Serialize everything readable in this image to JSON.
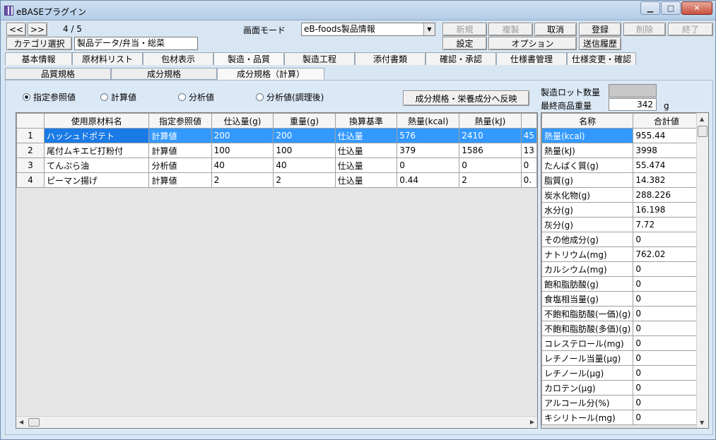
{
  "window": {
    "title": "eBASEプラグイン"
  },
  "nav": {
    "prev": "<<",
    "next": ">>",
    "record": "4 / 5"
  },
  "screen_mode": {
    "label": "画面モード",
    "value": "eB-foods製品情報"
  },
  "category": {
    "label": "カテゴリ選択",
    "value": "製品データ/弁当・総菜"
  },
  "toolbar": {
    "new": "新規",
    "copy": "複製",
    "cancel": "取消",
    "register": "登録",
    "delete": "削除",
    "exit": "終了",
    "settings": "設定",
    "options": "オプション",
    "send_history": "送信履歴"
  },
  "tabs": [
    "基本情報",
    "原材料リスト",
    "包材表示",
    "製造・品質",
    "製造工程",
    "添付書類",
    "確認・承認",
    "仕様書管理",
    "仕様変更・確認"
  ],
  "subtabs": [
    "品質規格",
    "成分規格",
    "成分規格（計算）"
  ],
  "radios": [
    "指定参照値",
    "計算値",
    "分析値",
    "分析値(調理後)"
  ],
  "reflect_button": "成分規格・栄養成分へ反映",
  "lot": {
    "label": "製造ロット数量",
    "value": ""
  },
  "final_weight": {
    "label": "最終商品重量",
    "value": "342",
    "unit": "g"
  },
  "grid": {
    "headers": [
      "",
      "使用原材料名",
      "指定参照値",
      "仕込量(g)",
      "重量(g)",
      "換算基準",
      "熱量(kcal)",
      "熱量(kJ)",
      ""
    ],
    "rows": [
      {
        "no": "1",
        "name": "ハッシュドポテト",
        "ref": "計算値",
        "prep": "200",
        "weight": "200",
        "basis": "仕込量",
        "kcal": "576",
        "kj": "2410",
        "extra": "45"
      },
      {
        "no": "2",
        "name": "尾付ムキエビ打粉付",
        "ref": "計算値",
        "prep": "100",
        "weight": "100",
        "basis": "仕込量",
        "kcal": "379",
        "kj": "1586",
        "extra": "13"
      },
      {
        "no": "3",
        "name": "てんぷら油",
        "ref": "分析値",
        "prep": "40",
        "weight": "40",
        "basis": "仕込量",
        "kcal": "0",
        "kj": "0",
        "extra": "0"
      },
      {
        "no": "4",
        "name": "ピーマン揚げ",
        "ref": "計算値",
        "prep": "2",
        "weight": "2",
        "basis": "仕込量",
        "kcal": "0.44",
        "kj": "2",
        "extra": "0."
      }
    ]
  },
  "totals": {
    "headers": [
      "名称",
      "合計値"
    ],
    "rows": [
      [
        "熱量(kcal)",
        "955.44"
      ],
      [
        "熱量(kJ)",
        "3998"
      ],
      [
        "たんぱく質(g)",
        "55.474"
      ],
      [
        "脂質(g)",
        "14.382"
      ],
      [
        "炭水化物(g)",
        "288.226"
      ],
      [
        "水分(g)",
        "16.198"
      ],
      [
        "灰分(g)",
        "7.72"
      ],
      [
        "その他成分(g)",
        "0"
      ],
      [
        "ナトリウム(mg)",
        "762.02"
      ],
      [
        "カルシウム(mg)",
        "0"
      ],
      [
        "飽和脂肪酸(g)",
        "0"
      ],
      [
        "食塩相当量(g)",
        "0"
      ],
      [
        "不飽和脂肪酸(一価)(g)",
        "0"
      ],
      [
        "不飽和脂肪酸(多価)(g)",
        "0"
      ],
      [
        "コレステロール(mg)",
        "0"
      ],
      [
        "レチノール当量(μg)",
        "0"
      ],
      [
        "レチノール(μg)",
        "0"
      ],
      [
        "カロテン(μg)",
        "0"
      ],
      [
        "アルコール分(%)",
        "0"
      ],
      [
        "キシリトール(mg)",
        "0"
      ]
    ]
  },
  "colors": {
    "selection": "#3399ff",
    "panel": "#dbe8f6"
  }
}
